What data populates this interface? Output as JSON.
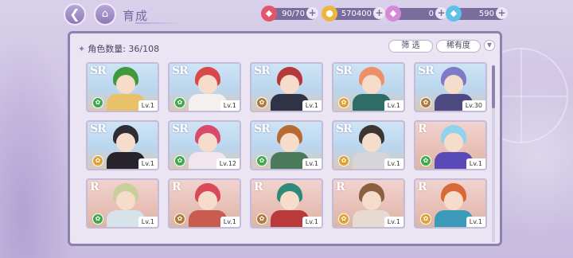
{
  "header": {
    "title": "育成",
    "back_icon": "back-arrow-icon",
    "home_icon": "home-icon"
  },
  "resources": [
    {
      "name": "stamina",
      "icon": "candy-icon",
      "value": "90/70",
      "color": "#e2566c"
    },
    {
      "name": "gold",
      "icon": "coin-icon",
      "value": "570400",
      "color": "#e9b73c"
    },
    {
      "name": "pink-gem",
      "icon": "pink-gem-icon",
      "value": "0",
      "color": "#d58ad8"
    },
    {
      "name": "blue-gem",
      "icon": "blue-diamond-icon",
      "value": "590",
      "color": "#5fc0e8"
    }
  ],
  "panel": {
    "count_label": "角色数量: 36/108",
    "filter_label": "筛 选",
    "sort_label": "稀有度",
    "sort_order_icon": "chevron-down-icon"
  },
  "cards": [
    {
      "rarity": "SR",
      "level": "Lv.1",
      "hair": "#3f9a3c",
      "outfit": "#e7c26a",
      "attr": "#3ea84a"
    },
    {
      "rarity": "SR",
      "level": "Lv.1",
      "hair": "#d84a4a",
      "outfit": "#f4f0ee",
      "attr": "#3ea84a"
    },
    {
      "rarity": "SR",
      "level": "Lv.1",
      "hair": "#b73a3a",
      "outfit": "#2f3346",
      "attr": "#b07a3a"
    },
    {
      "rarity": "SR",
      "level": "Lv.1",
      "hair": "#ec8f6a",
      "outfit": "#2d6d66",
      "attr": "#e0a130"
    },
    {
      "rarity": "SR",
      "level": "Lv.30",
      "hair": "#7e7ac6",
      "outfit": "#4c4a80",
      "attr": "#b07a3a"
    },
    {
      "rarity": "SR",
      "level": "Lv.1",
      "hair": "#2f2d33",
      "outfit": "#26242a",
      "attr": "#e0a130"
    },
    {
      "rarity": "SR",
      "level": "Lv.12",
      "hair": "#d94a6a",
      "outfit": "#f2e6ee",
      "attr": "#3ea84a"
    },
    {
      "rarity": "SR",
      "level": "Lv.1",
      "hair": "#b86a34",
      "outfit": "#4a7a5a",
      "attr": "#3ea84a"
    },
    {
      "rarity": "SR",
      "level": "Lv.1",
      "hair": "#3b3632",
      "outfit": "#d6d6d8",
      "attr": "#e0a130"
    },
    {
      "rarity": "R",
      "level": "Lv.1",
      "hair": "#8fd3ef",
      "outfit": "#5a4ab8",
      "attr": "#3ea84a"
    },
    {
      "rarity": "R",
      "level": "Lv.1",
      "hair": "#c8cf9a",
      "outfit": "#d6e3ea",
      "attr": "#3ea84a"
    },
    {
      "rarity": "R",
      "level": "Lv.1",
      "hair": "#d84a58",
      "outfit": "#c95b4f",
      "attr": "#b07a3a"
    },
    {
      "rarity": "R",
      "level": "Lv.1",
      "hair": "#2f8a7a",
      "outfit": "#b83a3a",
      "attr": "#b07a3a"
    },
    {
      "rarity": "R",
      "level": "Lv.1",
      "hair": "#8a6040",
      "outfit": "#e6dad2",
      "attr": "#e0a130"
    },
    {
      "rarity": "R",
      "level": "Lv.1",
      "hair": "#d86a3a",
      "outfit": "#3a9ab8",
      "attr": "#e0a130"
    }
  ]
}
